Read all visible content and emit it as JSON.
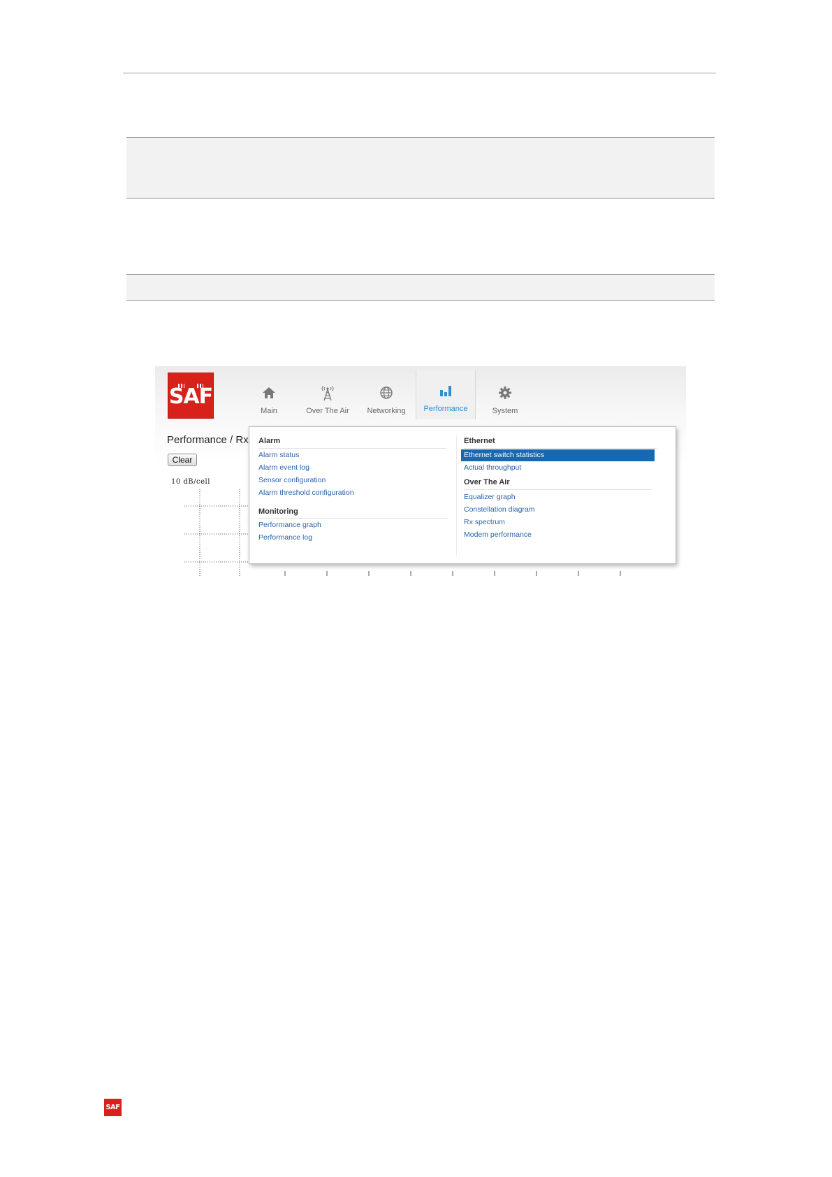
{
  "logo": {
    "text": "SAF"
  },
  "nav": {
    "items": [
      {
        "label": "Main",
        "icon": "home-icon"
      },
      {
        "label": "Over The Air",
        "icon": "antenna-icon"
      },
      {
        "label": "Networking",
        "icon": "globe-icon"
      },
      {
        "label": "Performance",
        "icon": "bar-chart-icon"
      },
      {
        "label": "System",
        "icon": "gear-icon"
      }
    ],
    "active": "Performance"
  },
  "page": {
    "heading": "Performance / Rx",
    "clear_label": "Clear",
    "chart_label": "10 dB/cell"
  },
  "menu": {
    "alarm": {
      "title": "Alarm",
      "items": [
        "Alarm status",
        "Alarm event log",
        "Sensor configuration",
        "Alarm threshold configuration"
      ]
    },
    "monitoring": {
      "title": "Monitoring",
      "items": [
        "Performance graph",
        "Performance log"
      ]
    },
    "ethernet": {
      "title": "Ethernet",
      "items": [
        "Ethernet switch statistics",
        "Actual throughput"
      ]
    },
    "over_the_air": {
      "title": "Over The Air",
      "items": [
        "Equalizer graph",
        "Constellation diagram",
        "Rx spectrum",
        "Modem performance"
      ]
    },
    "selected": "Ethernet switch statistics"
  },
  "colors": {
    "brand": "#d9211c",
    "link": "#2a63a8",
    "selection": "#1769b2",
    "active_tab": "#2d8fcf"
  },
  "footer": {
    "logo_text": "SAF"
  }
}
